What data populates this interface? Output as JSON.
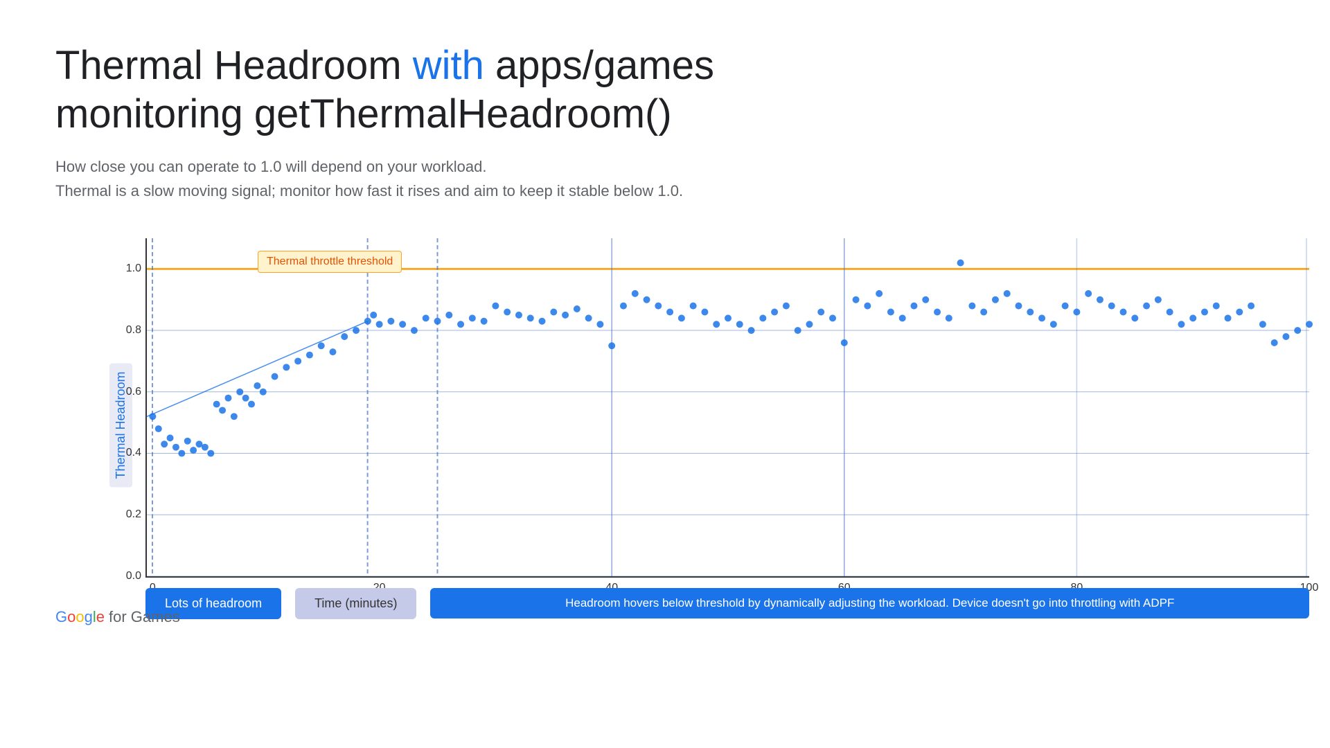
{
  "page": {
    "title_part1": "Thermal Headroom ",
    "title_keyword": "with",
    "title_part2": " apps/games",
    "title_line2": "monitoring getThermalHeadroom()",
    "subtitle_line1": "How close you can operate to 1.0 will depend on your workload.",
    "subtitle_line2": "Thermal is a slow moving signal; monitor how fast it rises and aim to keep it stable below 1.0.",
    "y_axis_label": "Thermal Headroom",
    "x_axis_label": "Time (minutes)",
    "threshold_label": "Thermal throttle threshold",
    "y_ticks": [
      "0.0",
      "0.2",
      "0.4",
      "0.6",
      "0.8",
      "1.0"
    ],
    "x_ticks": [
      "0",
      "20",
      "40",
      "60",
      "80",
      "100"
    ],
    "legend_lots_headroom": "Lots of headroom",
    "legend_time": "Time (minutes)",
    "legend_adpf": "Headroom hovers below threshold by dynamically adjusting the workload. Device doesn't go into throttling with ADPF",
    "google_logo": "Google for Games",
    "colors": {
      "accent_blue": "#1a73e8",
      "accent_yellow": "#f5a623",
      "data_point": "#1a73e8",
      "grid": "#4472c4",
      "threshold_bg": "#fef3cd",
      "threshold_text": "#e65100"
    },
    "data_points": [
      {
        "x": 0.5,
        "y": 0.52
      },
      {
        "x": 1,
        "y": 0.48
      },
      {
        "x": 1.5,
        "y": 0.43
      },
      {
        "x": 2,
        "y": 0.45
      },
      {
        "x": 2.5,
        "y": 0.42
      },
      {
        "x": 3,
        "y": 0.4
      },
      {
        "x": 3.5,
        "y": 0.44
      },
      {
        "x": 4,
        "y": 0.41
      },
      {
        "x": 4.5,
        "y": 0.43
      },
      {
        "x": 5,
        "y": 0.42
      },
      {
        "x": 5.5,
        "y": 0.4
      },
      {
        "x": 6,
        "y": 0.56
      },
      {
        "x": 6.5,
        "y": 0.54
      },
      {
        "x": 7,
        "y": 0.58
      },
      {
        "x": 7.5,
        "y": 0.52
      },
      {
        "x": 8,
        "y": 0.6
      },
      {
        "x": 8.5,
        "y": 0.58
      },
      {
        "x": 9,
        "y": 0.56
      },
      {
        "x": 9.5,
        "y": 0.62
      },
      {
        "x": 10,
        "y": 0.6
      },
      {
        "x": 11,
        "y": 0.65
      },
      {
        "x": 12,
        "y": 0.68
      },
      {
        "x": 13,
        "y": 0.7
      },
      {
        "x": 14,
        "y": 0.72
      },
      {
        "x": 15,
        "y": 0.75
      },
      {
        "x": 16,
        "y": 0.73
      },
      {
        "x": 17,
        "y": 0.78
      },
      {
        "x": 18,
        "y": 0.8
      },
      {
        "x": 19,
        "y": 0.83
      },
      {
        "x": 19.5,
        "y": 0.85
      },
      {
        "x": 20,
        "y": 0.82
      },
      {
        "x": 21,
        "y": 0.83
      },
      {
        "x": 22,
        "y": 0.82
      },
      {
        "x": 23,
        "y": 0.8
      },
      {
        "x": 24,
        "y": 0.84
      },
      {
        "x": 25,
        "y": 0.83
      },
      {
        "x": 26,
        "y": 0.85
      },
      {
        "x": 27,
        "y": 0.82
      },
      {
        "x": 28,
        "y": 0.84
      },
      {
        "x": 29,
        "y": 0.83
      },
      {
        "x": 30,
        "y": 0.88
      },
      {
        "x": 31,
        "y": 0.86
      },
      {
        "x": 32,
        "y": 0.85
      },
      {
        "x": 33,
        "y": 0.84
      },
      {
        "x": 34,
        "y": 0.83
      },
      {
        "x": 35,
        "y": 0.86
      },
      {
        "x": 36,
        "y": 0.85
      },
      {
        "x": 37,
        "y": 0.87
      },
      {
        "x": 38,
        "y": 0.84
      },
      {
        "x": 39,
        "y": 0.82
      },
      {
        "x": 40,
        "y": 0.75
      },
      {
        "x": 41,
        "y": 0.88
      },
      {
        "x": 42,
        "y": 0.92
      },
      {
        "x": 43,
        "y": 0.9
      },
      {
        "x": 44,
        "y": 0.88
      },
      {
        "x": 45,
        "y": 0.86
      },
      {
        "x": 46,
        "y": 0.84
      },
      {
        "x": 47,
        "y": 0.88
      },
      {
        "x": 48,
        "y": 0.86
      },
      {
        "x": 49,
        "y": 0.82
      },
      {
        "x": 50,
        "y": 0.84
      },
      {
        "x": 51,
        "y": 0.82
      },
      {
        "x": 52,
        "y": 0.8
      },
      {
        "x": 53,
        "y": 0.84
      },
      {
        "x": 54,
        "y": 0.86
      },
      {
        "x": 55,
        "y": 0.88
      },
      {
        "x": 56,
        "y": 0.8
      },
      {
        "x": 57,
        "y": 0.82
      },
      {
        "x": 58,
        "y": 0.86
      },
      {
        "x": 59,
        "y": 0.84
      },
      {
        "x": 60,
        "y": 0.76
      },
      {
        "x": 61,
        "y": 0.9
      },
      {
        "x": 62,
        "y": 0.88
      },
      {
        "x": 63,
        "y": 0.92
      },
      {
        "x": 64,
        "y": 0.86
      },
      {
        "x": 65,
        "y": 0.84
      },
      {
        "x": 66,
        "y": 0.88
      },
      {
        "x": 67,
        "y": 0.9
      },
      {
        "x": 68,
        "y": 0.86
      },
      {
        "x": 69,
        "y": 0.84
      },
      {
        "x": 70,
        "y": 1.02
      },
      {
        "x": 71,
        "y": 0.88
      },
      {
        "x": 72,
        "y": 0.86
      },
      {
        "x": 73,
        "y": 0.9
      },
      {
        "x": 74,
        "y": 0.92
      },
      {
        "x": 75,
        "y": 0.88
      },
      {
        "x": 76,
        "y": 0.86
      },
      {
        "x": 77,
        "y": 0.84
      },
      {
        "x": 78,
        "y": 0.82
      },
      {
        "x": 79,
        "y": 0.88
      },
      {
        "x": 80,
        "y": 0.86
      },
      {
        "x": 81,
        "y": 0.92
      },
      {
        "x": 82,
        "y": 0.9
      },
      {
        "x": 83,
        "y": 0.88
      },
      {
        "x": 84,
        "y": 0.86
      },
      {
        "x": 85,
        "y": 0.84
      },
      {
        "x": 86,
        "y": 0.88
      },
      {
        "x": 87,
        "y": 0.9
      },
      {
        "x": 88,
        "y": 0.86
      },
      {
        "x": 89,
        "y": 0.82
      },
      {
        "x": 90,
        "y": 0.84
      },
      {
        "x": 91,
        "y": 0.86
      },
      {
        "x": 92,
        "y": 0.88
      },
      {
        "x": 93,
        "y": 0.84
      },
      {
        "x": 94,
        "y": 0.86
      },
      {
        "x": 95,
        "y": 0.88
      },
      {
        "x": 96,
        "y": 0.82
      },
      {
        "x": 97,
        "y": 0.76
      },
      {
        "x": 98,
        "y": 0.78
      },
      {
        "x": 99,
        "y": 0.8
      },
      {
        "x": 100,
        "y": 0.82
      }
    ]
  }
}
